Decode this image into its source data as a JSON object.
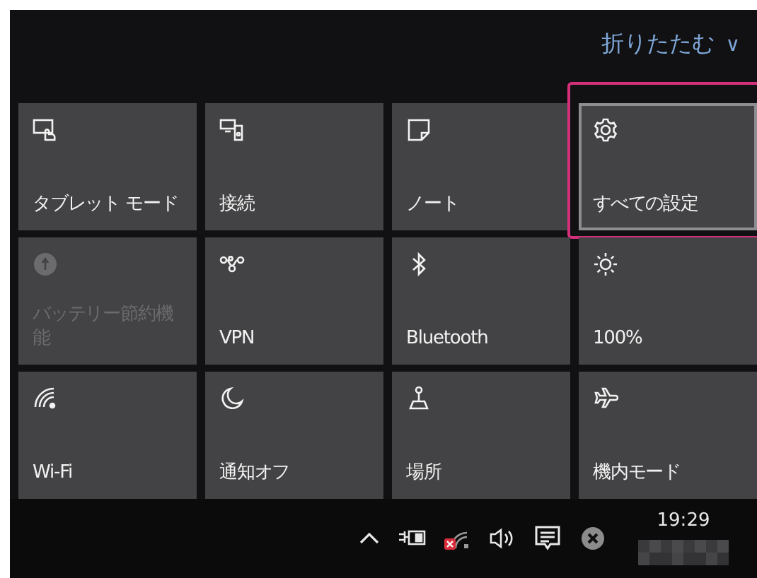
{
  "collapse_link": {
    "label": "折りたたむ",
    "chevron": "∨"
  },
  "tiles": [
    {
      "kind": "tablet",
      "label": "タブレット モード",
      "disabled": false,
      "selected": false,
      "highlighted": false
    },
    {
      "kind": "connect",
      "label": "接続",
      "disabled": false,
      "selected": false,
      "highlighted": false
    },
    {
      "kind": "note",
      "label": "ノート",
      "disabled": false,
      "selected": false,
      "highlighted": false
    },
    {
      "kind": "settings",
      "label": "すべての設定",
      "disabled": false,
      "selected": true,
      "highlighted": true
    },
    {
      "kind": "battery",
      "label": "バッテリー節約機能",
      "disabled": true,
      "selected": false,
      "highlighted": false
    },
    {
      "kind": "vpn",
      "label": "VPN",
      "disabled": false,
      "selected": false,
      "highlighted": false
    },
    {
      "kind": "bluetooth",
      "label": "Bluetooth",
      "disabled": false,
      "selected": false,
      "highlighted": false
    },
    {
      "kind": "brightness",
      "label": "100%",
      "disabled": false,
      "selected": false,
      "highlighted": false
    },
    {
      "kind": "wifi",
      "label": "Wi-Fi",
      "disabled": false,
      "selected": false,
      "highlighted": false
    },
    {
      "kind": "moon",
      "label": "通知オフ",
      "disabled": false,
      "selected": false,
      "highlighted": false
    },
    {
      "kind": "location",
      "label": "場所",
      "disabled": false,
      "selected": false,
      "highlighted": false
    },
    {
      "kind": "airplane",
      "label": "機内モード",
      "disabled": false,
      "selected": false,
      "highlighted": false
    }
  ],
  "taskbar": {
    "tray_icons": [
      {
        "kind": "chevron"
      },
      {
        "kind": "power"
      },
      {
        "kind": "network"
      },
      {
        "kind": "volume"
      },
      {
        "kind": "action_center"
      },
      {
        "kind": "close"
      }
    ],
    "time": "19:29"
  }
}
